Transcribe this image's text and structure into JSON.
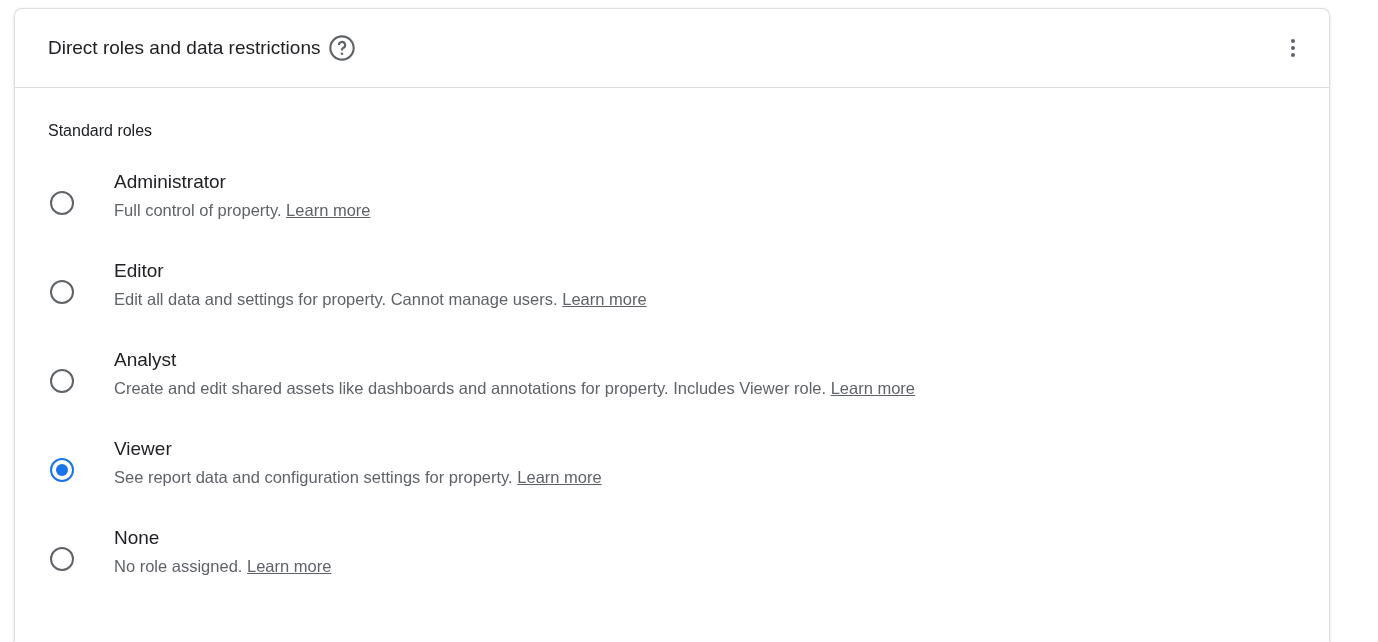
{
  "card": {
    "title": "Direct roles and data restrictions"
  },
  "section": {
    "heading": "Standard roles"
  },
  "roles": [
    {
      "name": "Administrator",
      "description": "Full control of property.",
      "link": "Learn more",
      "selected": false
    },
    {
      "name": "Editor",
      "description": "Edit all data and settings for property. Cannot manage users.",
      "link": "Learn more",
      "selected": false
    },
    {
      "name": "Analyst",
      "description": "Create and edit shared assets like dashboards and annotations for property. Includes Viewer role.",
      "link": "Learn more",
      "selected": false
    },
    {
      "name": "Viewer",
      "description": "See report data and configuration settings for property.",
      "link": "Learn more",
      "selected": true
    },
    {
      "name": "None",
      "description": "No role assigned.",
      "link": "Learn more",
      "selected": false
    }
  ]
}
